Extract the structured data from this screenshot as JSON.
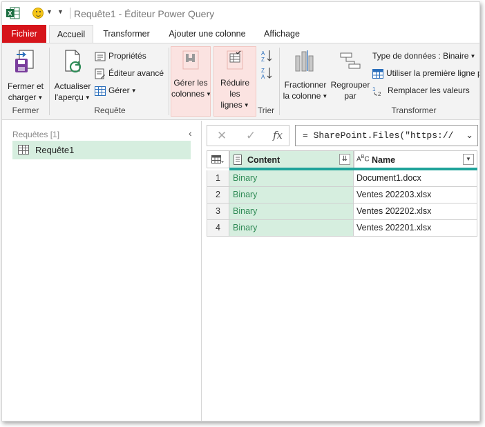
{
  "title_bar": {
    "title": "Requête1 - Éditeur Power Query"
  },
  "tabs": {
    "fichier": "Fichier",
    "accueil": "Accueil",
    "transformer": "Transformer",
    "ajouter": "Ajouter une colonne",
    "affichage": "Affichage"
  },
  "ribbon": {
    "fermer_group": {
      "label": "Fermer",
      "close_load_1": "Fermer et",
      "close_load_2": "charger"
    },
    "requete_group": {
      "label": "Requête",
      "refresh_1": "Actualiser",
      "refresh_2": "l'aperçu",
      "properties": "Propriétés",
      "advanced_editor": "Éditeur avancé",
      "manage": "Gérer"
    },
    "columns_group": {
      "manage_cols_1": "Gérer les",
      "manage_cols_2": "colonnes",
      "reduce_rows_1": "Réduire les",
      "reduce_rows_2": "lignes"
    },
    "trier_group": {
      "label": "Trier"
    },
    "transformer_group": {
      "label": "Transformer",
      "split_1": "Fractionner",
      "split_2": "la colonne",
      "group_by_1": "Regrouper",
      "group_by_2": "par",
      "data_type": "Type de données : Binaire",
      "first_row": "Utiliser la première ligne p",
      "replace": "Remplacer les valeurs"
    }
  },
  "queries": {
    "title": "Requêtes [1]",
    "items": [
      {
        "label": "Requête1"
      }
    ]
  },
  "formula_bar": {
    "formula": "= SharePoint.Files(\"https://"
  },
  "grid": {
    "columns": [
      {
        "label": "Content",
        "type_icon": "binary-icon"
      },
      {
        "label": "Name",
        "type_icon": "abc-text-icon"
      }
    ],
    "rows": [
      {
        "num": "1",
        "content": "Binary",
        "name": "Document1.docx"
      },
      {
        "num": "2",
        "content": "Binary",
        "name": "Ventes 202203.xlsx"
      },
      {
        "num": "3",
        "content": "Binary",
        "name": "Ventes 202202.xlsx"
      },
      {
        "num": "4",
        "content": "Binary",
        "name": "Ventes 202201.xlsx"
      }
    ]
  },
  "colors": {
    "file_tab": "#d6141a",
    "selected_green": "#d6eedf",
    "binary_text": "#2f8a55",
    "teal_bar": "#1fa39a",
    "highlight_btn": "#fbe3e1"
  }
}
